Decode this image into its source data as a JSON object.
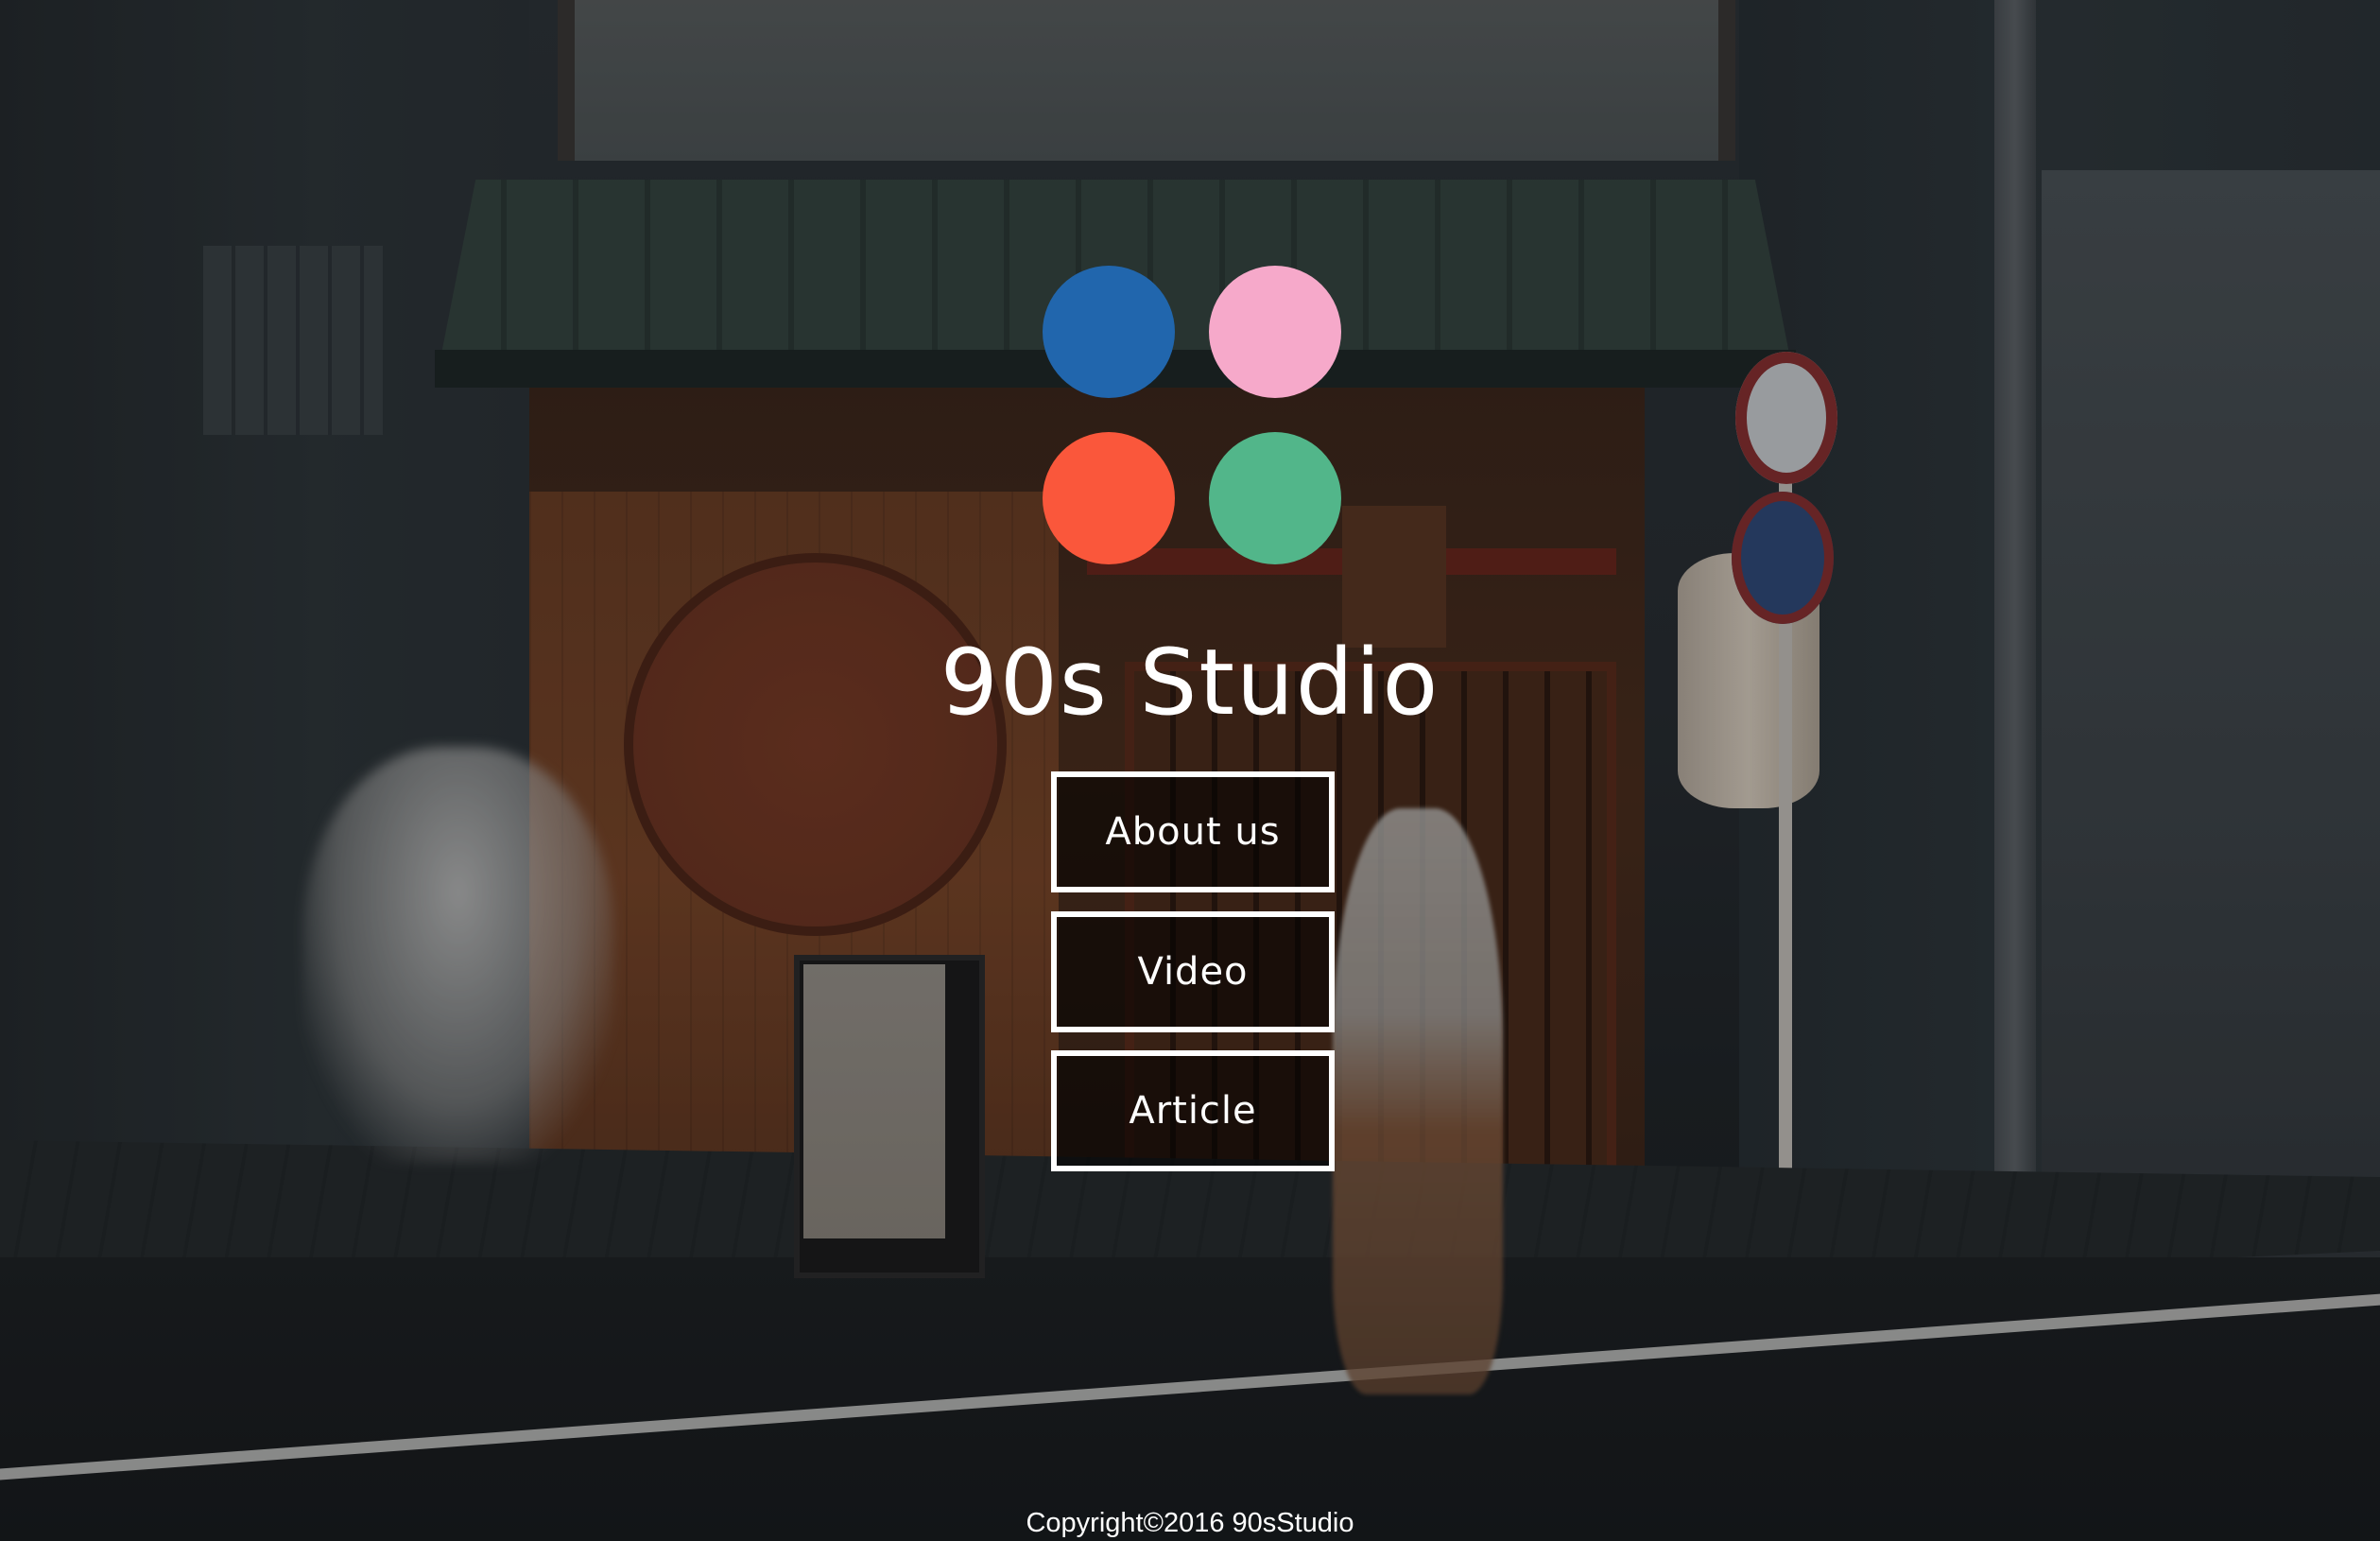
{
  "site": {
    "title": "90s Studio",
    "logo_colors": {
      "top_left": "#2166AD",
      "top_right": "#F6A9CA",
      "bottom_left": "#FA573B",
      "bottom_right": "#52B68A"
    }
  },
  "nav": {
    "items": [
      {
        "label": "About us"
      },
      {
        "label": "Video"
      },
      {
        "label": "Article"
      }
    ]
  },
  "footer": {
    "copyright": "Copyright©2016 90sStudio"
  },
  "colors": {
    "text": "#FFFFFF",
    "button_border": "#FFFFFF",
    "button_fill": "rgba(0,0,0,0.55)"
  }
}
